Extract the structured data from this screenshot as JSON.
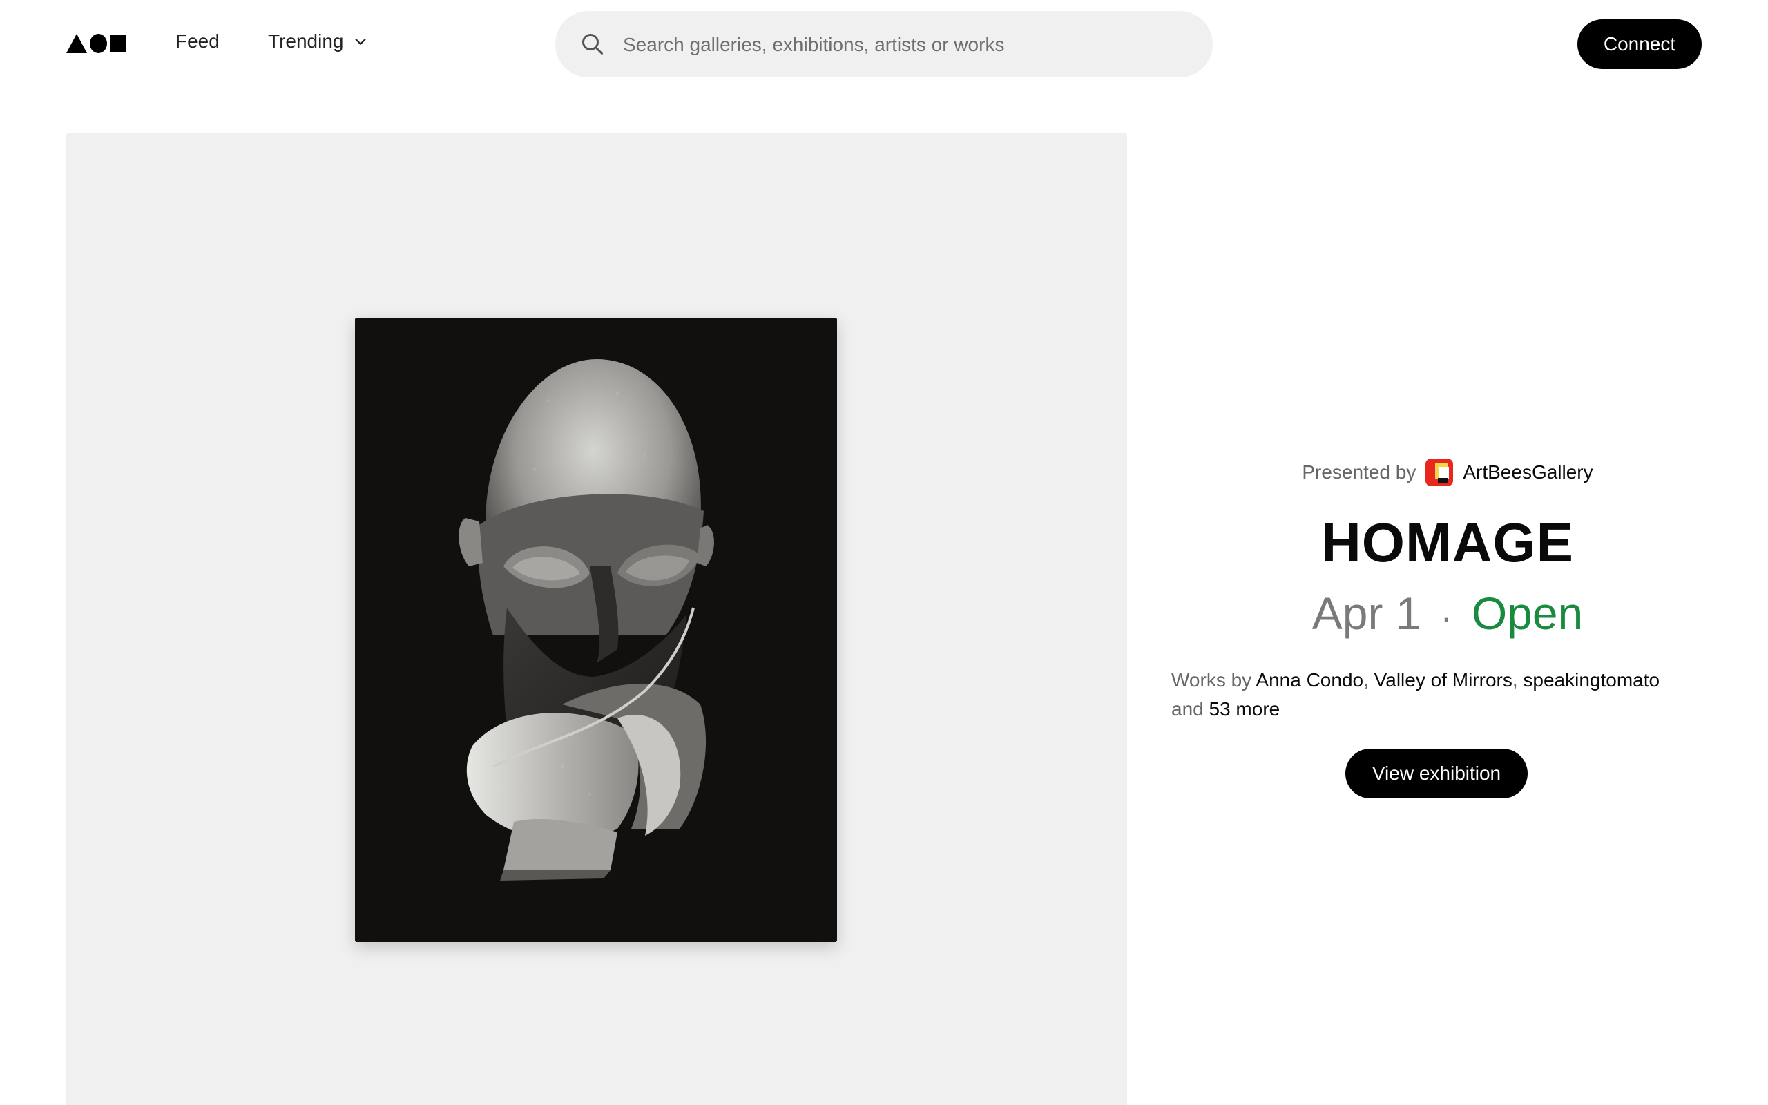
{
  "header": {
    "nav": {
      "feed": "Feed",
      "trending": "Trending"
    },
    "search": {
      "placeholder": "Search galleries, exhibitions, artists or works"
    },
    "connect": "Connect"
  },
  "exhibition": {
    "presented_by_label": "Presented by",
    "gallery_name": "ArtBeesGallery",
    "title": "HOMAGE",
    "date": "Apr 1",
    "separator": "·",
    "status": "Open",
    "works_by_label": "Works by",
    "artists": [
      "Anna Condo",
      "Valley of Mirrors",
      "speakingtomato"
    ],
    "and_label": "and",
    "more_label": "53 more",
    "view_button": "View exhibition"
  },
  "colors": {
    "status_open": "#1a8a3f",
    "button_bg": "#000000",
    "panel_bg": "#f0f0f0"
  }
}
